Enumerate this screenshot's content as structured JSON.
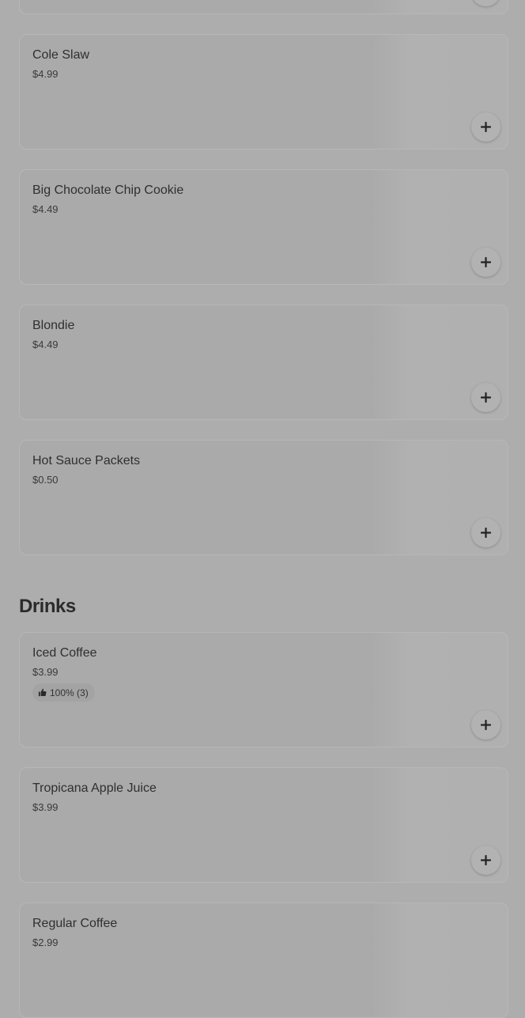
{
  "menu": {
    "sides": [
      {
        "name": "Cole Slaw",
        "price": "$4.99"
      },
      {
        "name": "Big Chocolate Chip Cookie",
        "price": "$4.49"
      },
      {
        "name": "Blondie",
        "price": "$4.49"
      },
      {
        "name": "Hot Sauce Packets",
        "price": "$0.50"
      }
    ],
    "drinks_title": "Drinks",
    "drinks": [
      {
        "name": "Iced Coffee",
        "price": "$3.99",
        "rating": "100% (3)"
      },
      {
        "name": "Tropicana Apple Juice",
        "price": "$3.99"
      },
      {
        "name": "Regular Coffee",
        "price": "$2.99"
      }
    ]
  },
  "icons": {
    "add": "plus-icon",
    "rating": "thumbs-up-icon"
  }
}
